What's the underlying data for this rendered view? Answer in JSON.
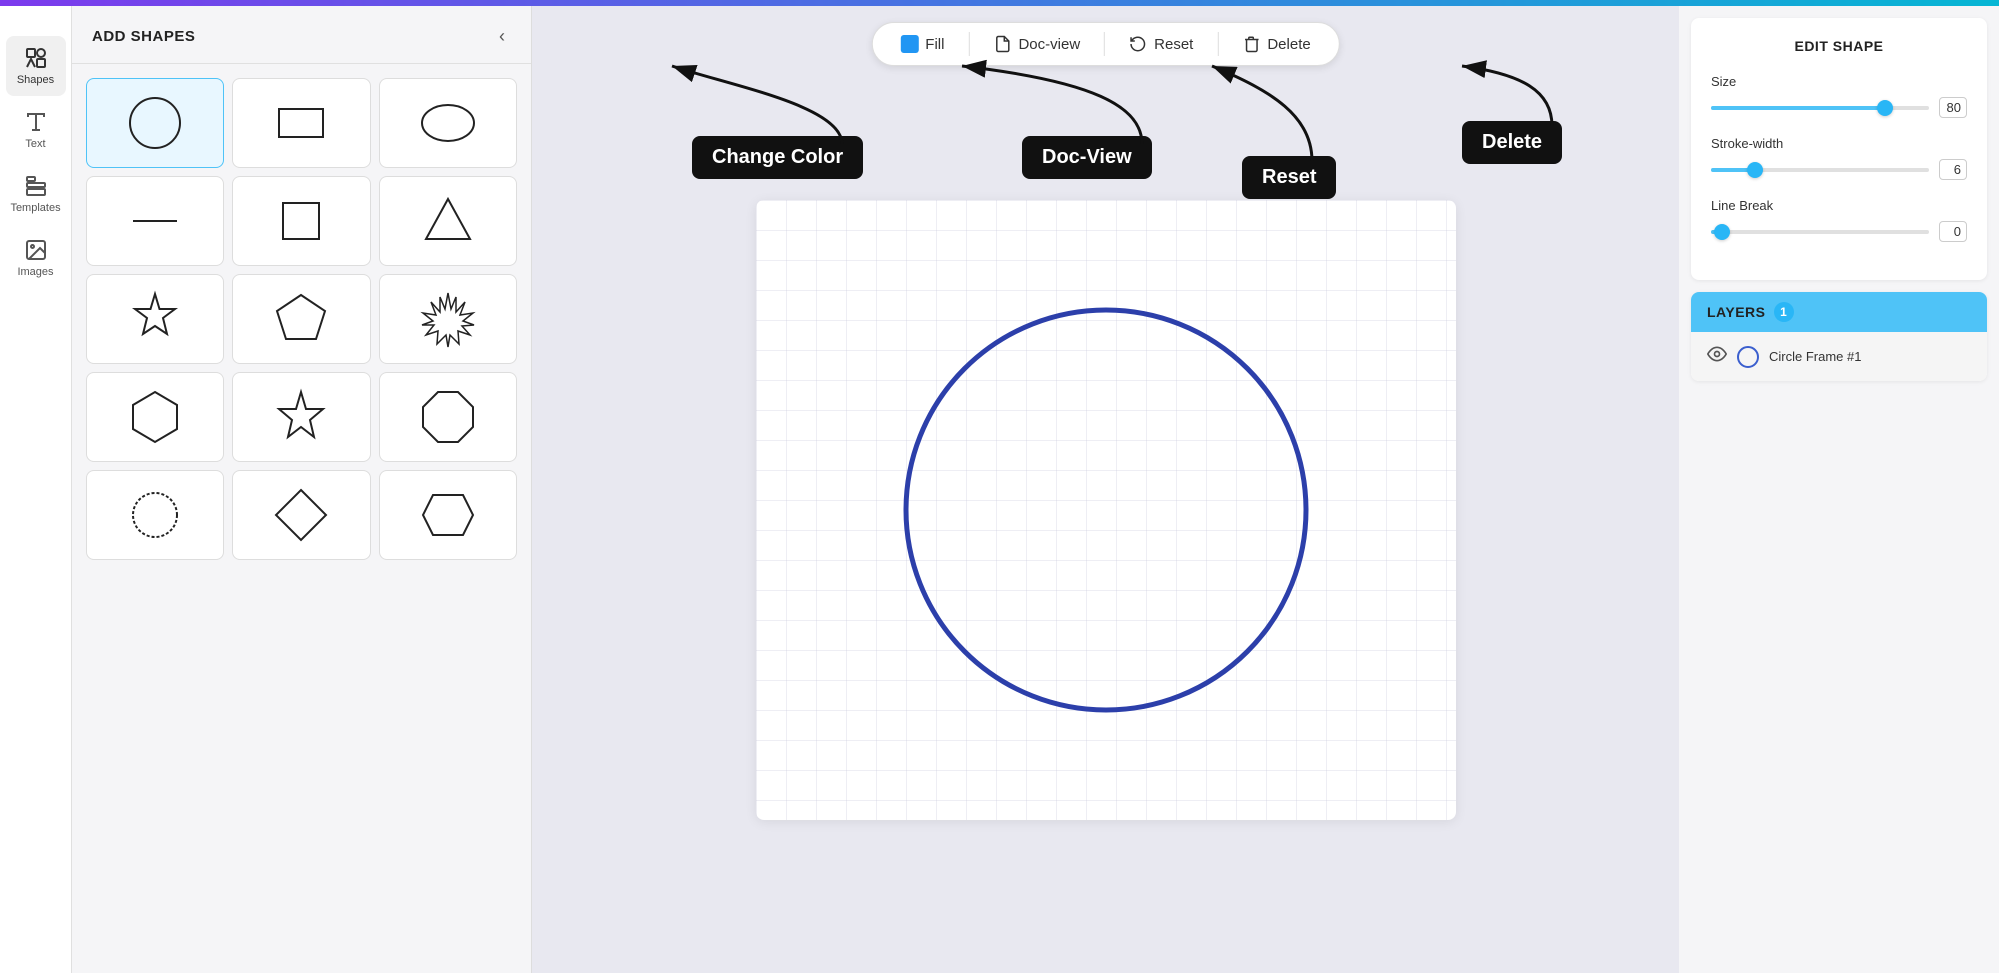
{
  "topBar": {},
  "iconSidebar": {
    "items": [
      {
        "id": "shapes",
        "label": "Shapes",
        "active": true
      },
      {
        "id": "text",
        "label": "Text",
        "active": false
      },
      {
        "id": "templates",
        "label": "Templates",
        "active": false
      },
      {
        "id": "images",
        "label": "Images",
        "active": false
      }
    ]
  },
  "shapesPanel": {
    "title": "ADD SHAPES",
    "collapseArrow": "‹"
  },
  "toolbar": {
    "fillLabel": "Fill",
    "docViewLabel": "Doc-view",
    "resetLabel": "Reset",
    "deleteLabel": "Delete"
  },
  "tooltips": {
    "changeColor": "Change Color",
    "docView": "Doc-View",
    "reset": "Reset",
    "delete": "Delete"
  },
  "editShape": {
    "title": "EDIT SHAPE",
    "sizeLabel": "Size",
    "sizeValue": "80",
    "sizePercent": 80,
    "strokeWidthLabel": "Stroke-width",
    "strokeWidthValue": "6",
    "strokeWidthPercent": 20,
    "lineBreakLabel": "Line Break",
    "lineBreakValue": "0",
    "lineBreakPercent": 5
  },
  "layers": {
    "title": "LAYERS",
    "badge": "1",
    "items": [
      {
        "name": "Circle Frame #1"
      }
    ]
  }
}
